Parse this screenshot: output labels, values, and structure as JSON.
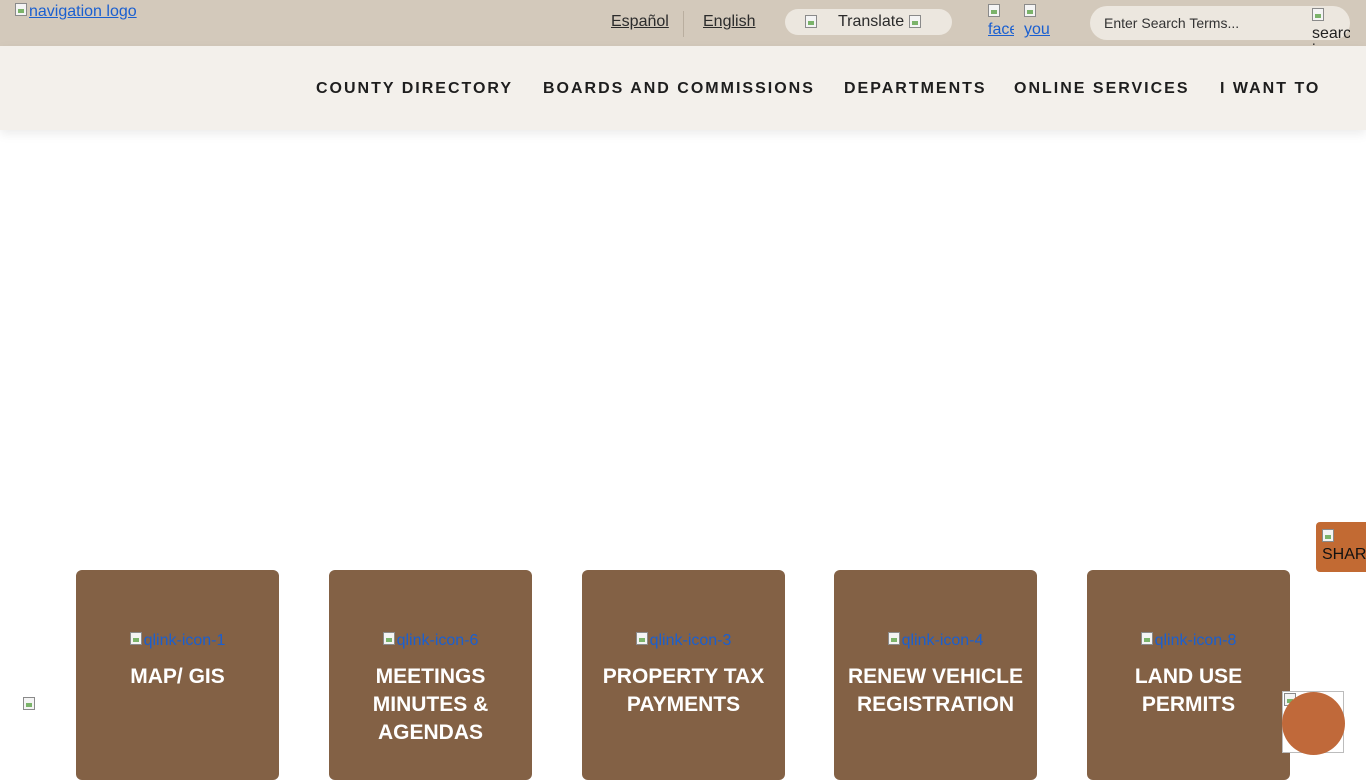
{
  "header": {
    "logo_alt": "navigation logo",
    "languages": [
      "Español",
      "English"
    ],
    "translate_label": "Translate",
    "social": {
      "facebook_alt": "facebook",
      "youtube_alt": "youtube"
    },
    "search": {
      "placeholder": "Enter Search Terms...",
      "button_alt": "search icon"
    }
  },
  "nav": {
    "items": [
      "COUNTY DIRECTORY",
      "BOARDS AND COMMISSIONS",
      "DEPARTMENTS",
      "ONLINE SERVICES",
      "I WANT TO"
    ]
  },
  "share_alt": "SHARE",
  "cards": [
    {
      "icon_alt": "qlink-icon-1",
      "label": "MAP/ GIS"
    },
    {
      "icon_alt": "qlink-icon-6",
      "label": "MEETINGS MINUTES & AGENDAS"
    },
    {
      "icon_alt": "qlink-icon-3",
      "label": "PROPERTY TAX PAYMENTS"
    },
    {
      "icon_alt": "qlink-icon-4",
      "label": "RENEW VEHICLE REGISTRATION"
    },
    {
      "icon_alt": "qlink-icon-8",
      "label": "LAND USE PERMITS"
    }
  ],
  "colors": {
    "topbar": "#d3c9bb",
    "navbar": "#f3f0eb",
    "card": "#836145",
    "accent": "#c26a33"
  }
}
